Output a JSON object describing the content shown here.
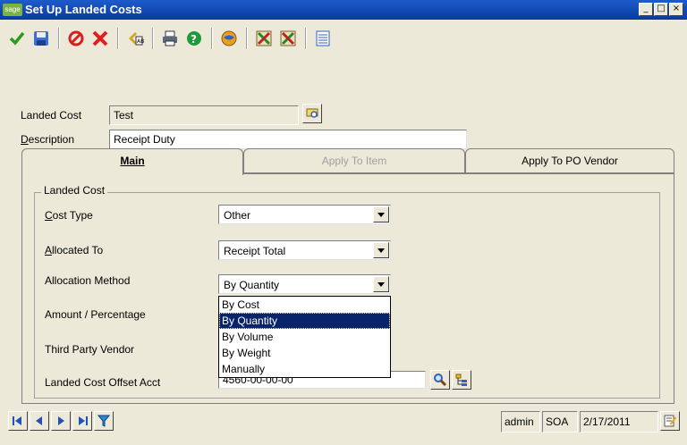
{
  "window": {
    "logo_text": "sage",
    "title": "Set Up Landed Costs",
    "buttons": [
      "_",
      "□",
      "×"
    ]
  },
  "toolbar": {
    "icons": [
      "check-icon",
      "save-icon",
      "cancel-icon",
      "delete-icon",
      "rename-icon",
      "print-icon",
      "help-icon",
      "globe-icon",
      "export-icon",
      "import-icon",
      "layout-icon"
    ]
  },
  "header": {
    "landed_cost_label": "Landed Cost",
    "landed_cost_value": "Test",
    "description_label": "Description",
    "description_value": "Receipt Duty"
  },
  "tabs": [
    {
      "label": "Main",
      "state": "active"
    },
    {
      "label": "Apply To Item",
      "state": "disabled"
    },
    {
      "label": "Apply To PO Vendor",
      "state": "inactive"
    }
  ],
  "group": {
    "title": "Landed Cost",
    "cost_type_label": "Cost Type",
    "cost_type_value": "Other",
    "allocated_to_label": "Allocated To",
    "allocated_to_value": "Receipt Total",
    "allocation_method_label": "Allocation Method",
    "allocation_method_value": "By Quantity",
    "amount_label": "Amount / Percentage",
    "third_party_label": "Third Party Vendor",
    "offset_acct_label": "Landed Cost Offset Acct",
    "offset_acct_value": "4560-00-00-00"
  },
  "dropdown": {
    "options": [
      "By Cost",
      "By Quantity",
      "By Volume",
      "By Weight",
      "Manually"
    ],
    "selected": "By Quantity"
  },
  "status": {
    "user": "admin",
    "company": "SOA",
    "date": "2/17/2011"
  },
  "colors": {
    "title_bar": "#0a3a9e",
    "selection": "#0a246a",
    "window_bg": "#ece9d8"
  }
}
